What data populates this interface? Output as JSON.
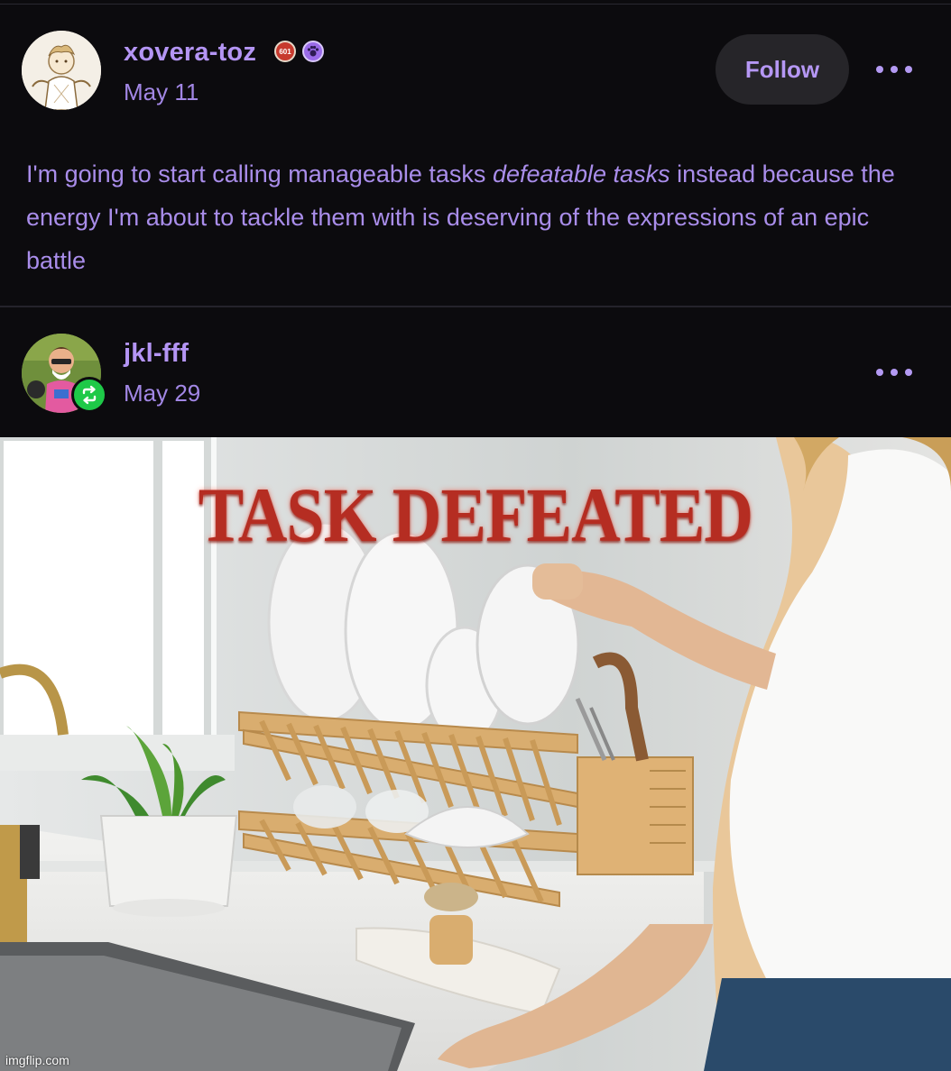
{
  "post1": {
    "username": "xovera-toz",
    "date": "May 11",
    "follow_label": "Follow",
    "badge1_text": "601",
    "body_part1": "I'm going to start calling manageable tasks ",
    "body_emphasis": "defeatable tasks",
    "body_part2": " instead because the energy I'm about to tackle them with is deserving of the expressions of an epic battle"
  },
  "post2": {
    "username": "jkl-fff",
    "date": "May 29"
  },
  "image": {
    "caption": "TASK DEFEATED",
    "watermark": "imgflip.com"
  },
  "colors": {
    "background": "#0c0b0e",
    "accent": "#b495f4",
    "reblog": "#1ec948",
    "meme_text": "#b52d22"
  }
}
